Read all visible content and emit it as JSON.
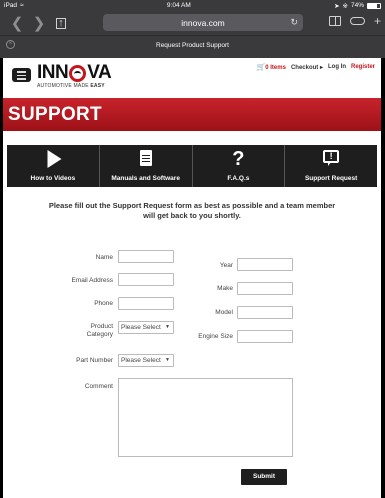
{
  "status_bar": {
    "device": "iPad",
    "time": "9:04 AM",
    "battery": "74%"
  },
  "browser": {
    "url": "innova.com",
    "tab_title": "Request Product Support"
  },
  "header": {
    "logo_text_left": "INN",
    "logo_text_right": "VA",
    "logo_tagline_prefix": "AUTOMOTIVE MADE ",
    "logo_tagline_bold": "EASY",
    "cart": "0 Items",
    "checkout": "Checkout",
    "login": "Log In",
    "register": "Register"
  },
  "banner": {
    "title": "SUPPORT"
  },
  "nav_icons": [
    {
      "label": "How to Videos",
      "icon": "play-icon"
    },
    {
      "label": "Manuals and Software",
      "icon": "document-icon"
    },
    {
      "label": "F.A.Q.s",
      "icon": "question-mark-icon"
    },
    {
      "label": "Support Request",
      "icon": "alert-bubble-icon"
    }
  ],
  "intro_text": "Please fill out the Support Request form as best as possible and a team member will get back to you shortly.",
  "form": {
    "name_label": "Name",
    "email_label": "Email Address",
    "phone_label": "Phone",
    "category_label": "Product Category",
    "part_label": "Part Number",
    "comment_label": "Comment",
    "year_label": "Year",
    "make_label": "Make",
    "model_label": "Model",
    "engine_label": "Engine Size",
    "select_placeholder": "Please Select",
    "submit_label": "Submit"
  }
}
